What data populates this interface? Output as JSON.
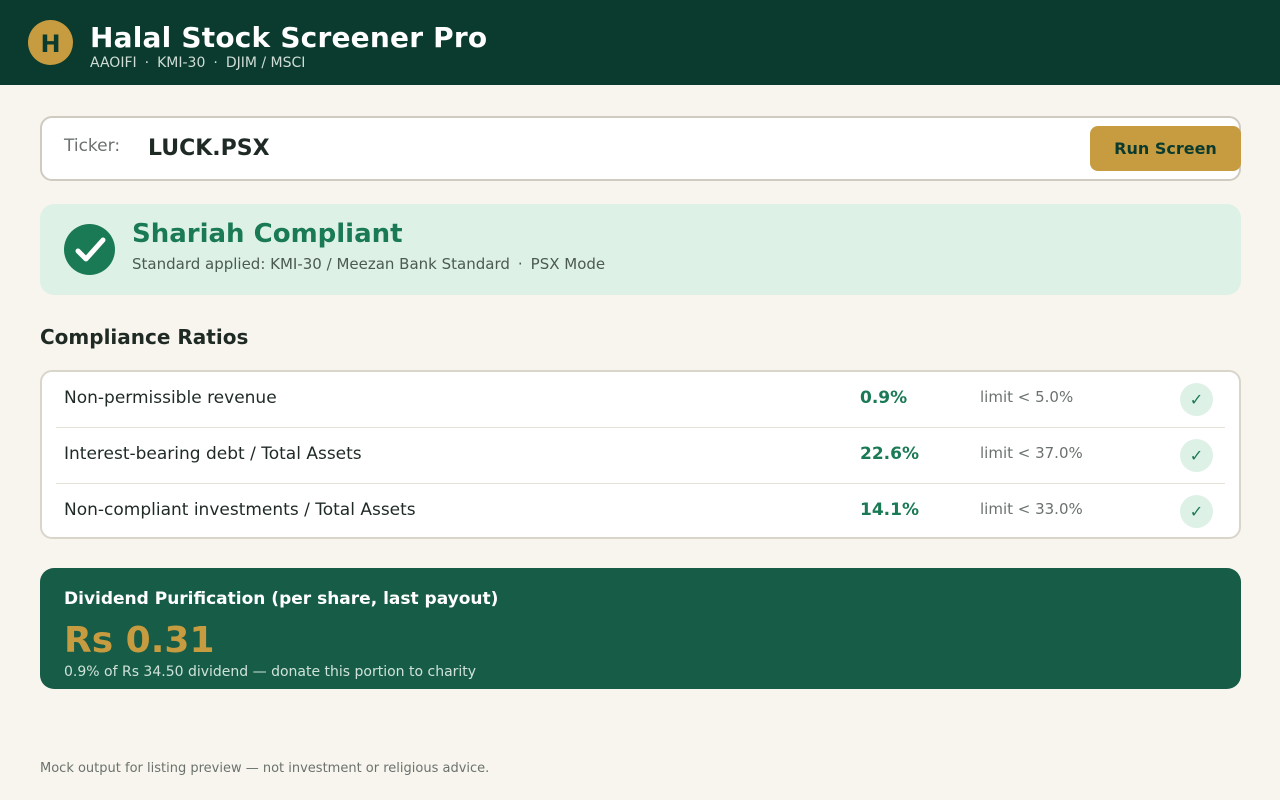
{
  "header": {
    "logo_letter": "H",
    "title": "Halal Stock Screener Pro",
    "standards": [
      "AAOIFI",
      "KMI-30",
      "DJIM / MSCI"
    ]
  },
  "ticker": {
    "label": "Ticker:",
    "value": "LUCK.PSX",
    "run_label": "Run Screen"
  },
  "status": {
    "icon": "check-icon",
    "title": "Shariah Compliant",
    "standard_text": "Standard applied: KMI-30 / Meezan Bank Standard",
    "mode_text": "PSX Mode"
  },
  "ratios": {
    "heading": "Compliance Ratios",
    "rows": [
      {
        "name": "Non-permissible revenue",
        "value": "0.9%",
        "limit": "limit < 5.0%",
        "status_icon": "✓"
      },
      {
        "name": "Interest-bearing debt / Total Assets",
        "value": "22.6%",
        "limit": "limit < 37.0%",
        "status_icon": "✓"
      },
      {
        "name": "Non-compliant investments / Total Assets",
        "value": "14.1%",
        "limit": "limit < 33.0%",
        "status_icon": "✓"
      }
    ]
  },
  "purification": {
    "title": "Dividend Purification (per share, last payout)",
    "amount": "Rs 0.31",
    "note": "0.9% of Rs 34.50 dividend — donate this portion to charity"
  },
  "footer": {
    "disclaimer": "Mock output for listing preview — not investment or religious advice."
  },
  "colors": {
    "header_bg": "#0a3b2e",
    "accent_gold": "#c79b3f",
    "compliant_green": "#1a7a55",
    "card_green": "#165c47",
    "page_bg": "#f8f5ee"
  }
}
